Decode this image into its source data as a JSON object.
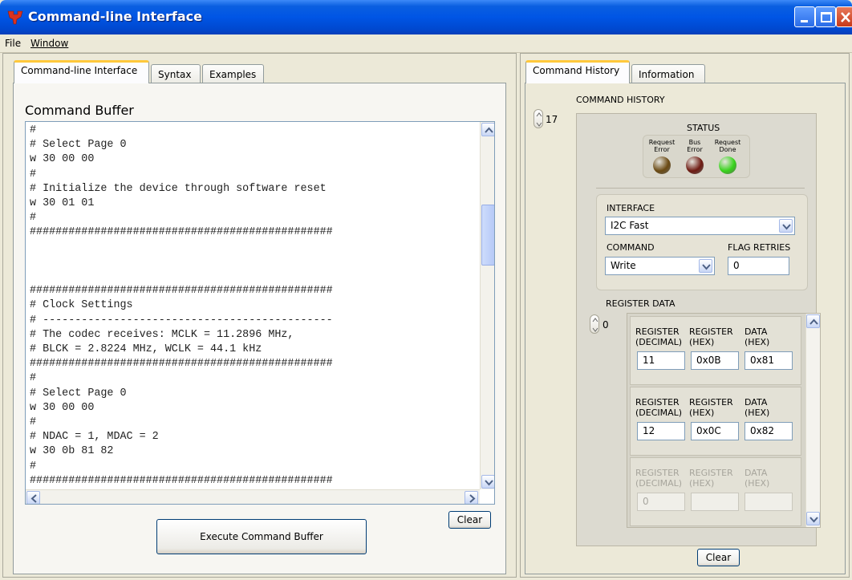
{
  "window": {
    "title": "Command-line Interface"
  },
  "menu": {
    "file": "File",
    "window": "Window"
  },
  "left_tabs": [
    "Command-line Interface",
    "Syntax",
    "Examples"
  ],
  "buffer": {
    "heading": "Command Buffer",
    "lines": [
      "#",
      "# Select Page 0",
      "w 30 00 00",
      "#",
      "# Initialize the device through software reset",
      "w 30 01 01",
      "#",
      "###############################################",
      "",
      "",
      "",
      "###############################################",
      "# Clock Settings",
      "# ---------------------------------------------",
      "# The codec receives: MCLK = 11.2896 MHz,",
      "# BLCK = 2.8224 MHz, WCLK = 44.1 kHz",
      "###############################################",
      "#",
      "# Select Page 0",
      "w 30 00 00",
      "#",
      "# NDAC = 1, MDAC = 2",
      "w 30 0b 81 82",
      "#",
      "###############################################"
    ],
    "clear_label": "Clear",
    "execute_label": "Execute Command Buffer"
  },
  "right_tabs": [
    "Command History",
    "Information"
  ],
  "history": {
    "heading": "COMMAND HISTORY",
    "index": "17",
    "status": {
      "heading": "STATUS",
      "leds": [
        {
          "label": "Request Error",
          "color": "#6b4a13"
        },
        {
          "label": "Bus Error",
          "color": "#6e1a12"
        },
        {
          "label": "Request Done",
          "color": "#37d31b"
        }
      ]
    },
    "interface_label": "INTERFACE",
    "interface_value": "I2C Fast",
    "command_label": "COMMAND",
    "command_value": "Write",
    "flag_retries_label": "FLAG RETRIES",
    "flag_retries_value": "0",
    "register_data_label": "REGISTER DATA",
    "register_index": "0",
    "reg_headers": [
      "REGISTER (DECIMAL)",
      "REGISTER (HEX)",
      "DATA (HEX)"
    ],
    "registers": [
      {
        "decimal": "11",
        "hex": "0x0B",
        "data": "0x81"
      },
      {
        "decimal": "12",
        "hex": "0x0C",
        "data": "0x82"
      },
      {
        "decimal": "0",
        "hex": "",
        "data": ""
      }
    ],
    "clear_label": "Clear"
  }
}
